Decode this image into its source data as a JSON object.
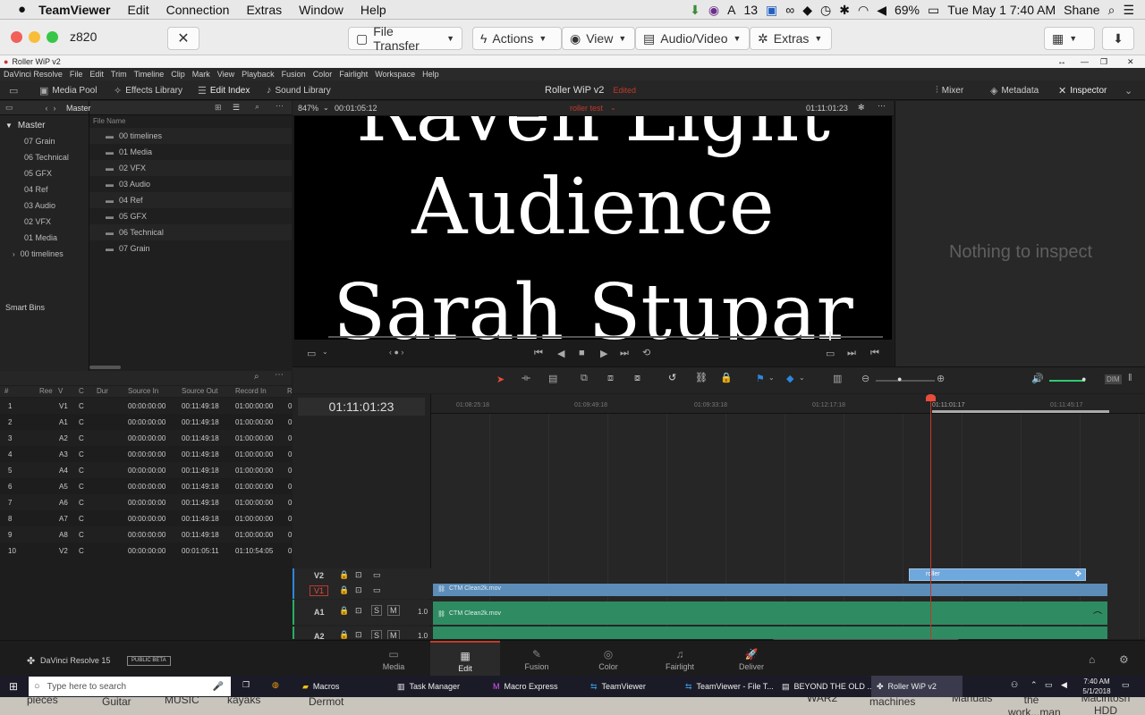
{
  "mac": {
    "app": "TeamViewer",
    "menus": [
      "Edit",
      "Connection",
      "Extras",
      "Window",
      "Help"
    ],
    "status": {
      "badge": "13",
      "battery": "69%",
      "clock": "Tue May 1  7:40 AM",
      "user": "Shane"
    }
  },
  "tv": {
    "session": "z820",
    "buttons": [
      {
        "label": "File Transfer"
      },
      {
        "label": "Actions"
      },
      {
        "label": "View"
      },
      {
        "label": "Audio/Video"
      },
      {
        "label": "Extras"
      }
    ]
  },
  "resolve": {
    "window_title": "Roller WiP v2",
    "menus": [
      "DaVinci Resolve",
      "File",
      "Edit",
      "Trim",
      "Timeline",
      "Clip",
      "Mark",
      "View",
      "Playback",
      "Fusion",
      "Color",
      "Fairlight",
      "Workspace",
      "Help"
    ],
    "toolbar": {
      "media_pool": "Media Pool",
      "effects": "Effects Library",
      "edit_index": "Edit Index",
      "sound": "Sound Library",
      "project": "Roller WiP v2",
      "edited": "Edited",
      "mixer": "Mixer",
      "metadata": "Metadata",
      "inspector": "Inspector"
    },
    "bins": {
      "master": "Master",
      "items": [
        "07 Grain",
        "06 Technical",
        "05 GFX",
        "04 Ref",
        "03 Audio",
        "02 VFX",
        "01 Media",
        "00 timelines"
      ],
      "smart_bins": "Smart Bins"
    },
    "files": {
      "header": "Master",
      "column": "File Name",
      "items": [
        "00 timelines",
        "01 Media",
        "02 VFX",
        "03 Audio",
        "04 Ref",
        "05 GFX",
        "06 Technical",
        "07 Grain"
      ]
    },
    "viewer": {
      "zoom": "847%",
      "duration": "00:01:05:12",
      "clip": "roller test",
      "timecode": "01:11:01:23",
      "lines": [
        "Raven Light",
        "Audience",
        "Sarah Stupar"
      ]
    },
    "inspector_empty": "Nothing to inspect",
    "edl": {
      "headers": [
        "#",
        "Ree",
        "V",
        "C",
        "Dur",
        "Source In",
        "Source Out",
        "Record In",
        "R"
      ],
      "rows": [
        [
          "1",
          "",
          "V1",
          "C",
          "",
          "00:00:00:00",
          "00:11:49:18",
          "01:00:00:00",
          "0"
        ],
        [
          "2",
          "",
          "A1",
          "C",
          "",
          "00:00:00:00",
          "00:11:49:18",
          "01:00:00:00",
          "0"
        ],
        [
          "3",
          "",
          "A2",
          "C",
          "",
          "00:00:00:00",
          "00:11:49:18",
          "01:00:00:00",
          "0"
        ],
        [
          "4",
          "",
          "A3",
          "C",
          "",
          "00:00:00:00",
          "00:11:49:18",
          "01:00:00:00",
          "0"
        ],
        [
          "5",
          "",
          "A4",
          "C",
          "",
          "00:00:00:00",
          "00:11:49:18",
          "01:00:00:00",
          "0"
        ],
        [
          "6",
          "",
          "A5",
          "C",
          "",
          "00:00:00:00",
          "00:11:49:18",
          "01:00:00:00",
          "0"
        ],
        [
          "7",
          "",
          "A6",
          "C",
          "",
          "00:00:00:00",
          "00:11:49:18",
          "01:00:00:00",
          "0"
        ],
        [
          "8",
          "",
          "A7",
          "C",
          "",
          "00:00:00:00",
          "00:11:49:18",
          "01:00:00:00",
          "0"
        ],
        [
          "9",
          "",
          "A8",
          "C",
          "",
          "00:00:00:00",
          "00:11:49:18",
          "01:00:00:00",
          "0"
        ],
        [
          "10",
          "",
          "V2",
          "C",
          "",
          "00:00:00:00",
          "00:01:05:11",
          "01:10:54:05",
          "0"
        ]
      ]
    },
    "timeline": {
      "timecode": "01:11:01:23",
      "ruler": [
        "01:08:25:18",
        "01:09:49:18",
        "01:09:33:18",
        "01:12:17:18",
        "01:11:01:17",
        "01:11:45:17"
      ],
      "tracks": [
        "V2",
        "V1",
        "A1",
        "A2"
      ],
      "clip_v1": "CTM Clean2k.mov",
      "clip_a1": "CTM Clean2k.mov",
      "clip_v2": "roller",
      "a_level": "1.0"
    },
    "pages": [
      {
        "label": "Media",
        "icon": "▭"
      },
      {
        "label": "Edit",
        "icon": "▦"
      },
      {
        "label": "Fusion",
        "icon": "✎"
      },
      {
        "label": "Color",
        "icon": "◎"
      },
      {
        "label": "Fairlight",
        "icon": "♫"
      },
      {
        "label": "Deliver",
        "icon": "🚀"
      }
    ],
    "brand": "DaVinci Resolve 15",
    "beta": "PUBLIC BETA"
  },
  "win": {
    "search_placeholder": "Type here to search",
    "tasks": [
      {
        "label": "Macros"
      },
      {
        "label": "Task Manager"
      },
      {
        "label": "Macro Express"
      },
      {
        "label": "TeamViewer"
      },
      {
        "label": "TeamViewer - File T..."
      },
      {
        "label": "BEYOND THE OLD ..."
      },
      {
        "label": "Roller WiP v2"
      }
    ],
    "time": "7:40 AM",
    "date": "5/1/2018"
  },
  "dock": [
    "pieces",
    "Guitar",
    "MUSIC",
    "kayaks",
    "Dermot",
    "WAR2",
    "machines",
    "Manuals",
    "the work...man",
    "Macintosh HDD"
  ]
}
